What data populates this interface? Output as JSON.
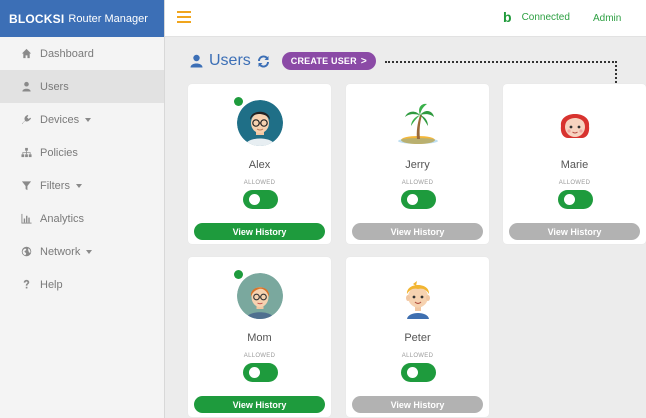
{
  "app": {
    "brand_bold": "BLOCKSI",
    "brand_rest": "Router Manager"
  },
  "topbar": {
    "connection_icon": "b",
    "connection_status": "Connected",
    "admin_label": "Admin"
  },
  "sidebar": {
    "items": [
      {
        "label": "Dashboard",
        "icon": "home-icon",
        "active": false
      },
      {
        "label": "Users",
        "icon": "user-icon",
        "active": true
      },
      {
        "label": "Devices",
        "icon": "plug-icon",
        "active": false,
        "dropdown": true
      },
      {
        "label": "Policies",
        "icon": "sitemap-icon",
        "active": false
      },
      {
        "label": "Filters",
        "icon": "filter-icon",
        "active": false,
        "dropdown": true
      },
      {
        "label": "Analytics",
        "icon": "bar-chart-icon",
        "active": false
      },
      {
        "label": "Network",
        "icon": "globe-icon",
        "active": false,
        "dropdown": true
      },
      {
        "label": "Help",
        "icon": "question-icon",
        "active": false
      }
    ]
  },
  "main": {
    "title": "Users",
    "create_button": "CREATE USER",
    "create_chevron": ">",
    "users": [
      {
        "name": "Alex",
        "status": "ALLOWED",
        "online": true,
        "history_button": "View History",
        "history_enabled": true,
        "avatar": "man-with-glasses"
      },
      {
        "name": "Jerry",
        "status": "ALLOWED",
        "online": false,
        "history_button": "View History",
        "history_enabled": false,
        "avatar": "palm-tree-island"
      },
      {
        "name": "Marie",
        "status": "ALLOWED",
        "online": false,
        "history_button": "View History",
        "history_enabled": false,
        "avatar": "red-haired-girl"
      },
      {
        "name": "Mom",
        "status": "ALLOWED",
        "online": true,
        "history_button": "View History",
        "history_enabled": true,
        "avatar": "woman-with-glasses"
      },
      {
        "name": "Peter",
        "status": "ALLOWED",
        "online": false,
        "history_button": "View History",
        "history_enabled": false,
        "avatar": "blond-boy"
      }
    ]
  },
  "colors": {
    "brand_blue": "#3c6fb6",
    "green": "#1e9b3d",
    "purple": "#8b4aa6",
    "orange": "#f0a51d",
    "disabled_gray": "#b2b2b2"
  }
}
